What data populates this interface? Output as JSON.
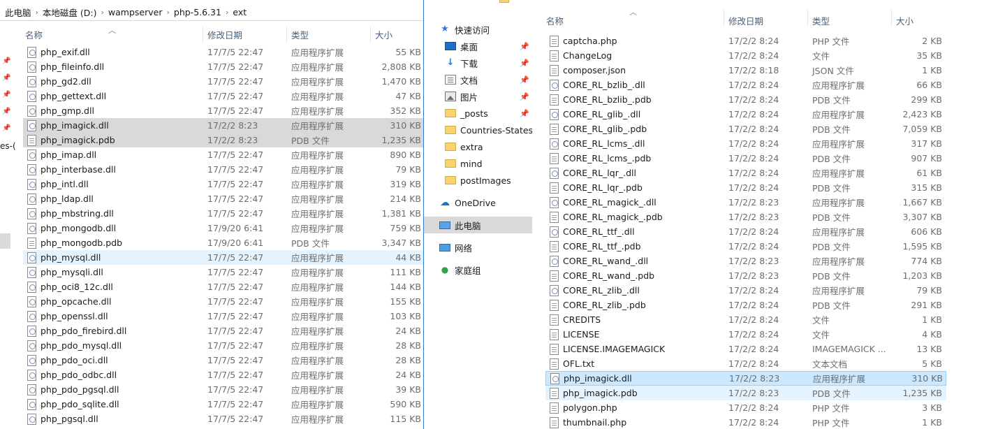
{
  "left": {
    "breadcrumb": [
      "此电脑",
      "本地磁盘 (D:)",
      "wampserver",
      "php-5.6.31",
      "ext"
    ],
    "nav_fragment": "es-(",
    "columns": {
      "name": "名称",
      "date": "修改日期",
      "type": "类型",
      "size": "大小"
    },
    "files": [
      {
        "name": "php_exif.dll",
        "date": "17/7/5 22:47",
        "type": "应用程序扩展",
        "size": "55 KB",
        "icon": "dll"
      },
      {
        "name": "php_fileinfo.dll",
        "date": "17/7/5 22:47",
        "type": "应用程序扩展",
        "size": "2,808 KB",
        "icon": "dll"
      },
      {
        "name": "php_gd2.dll",
        "date": "17/7/5 22:47",
        "type": "应用程序扩展",
        "size": "1,470 KB",
        "icon": "dll"
      },
      {
        "name": "php_gettext.dll",
        "date": "17/7/5 22:47",
        "type": "应用程序扩展",
        "size": "47 KB",
        "icon": "dll"
      },
      {
        "name": "php_gmp.dll",
        "date": "17/7/5 22:47",
        "type": "应用程序扩展",
        "size": "352 KB",
        "icon": "dll"
      },
      {
        "name": "php_imagick.dll",
        "date": "17/2/2 8:23",
        "type": "应用程序扩展",
        "size": "310 KB",
        "icon": "dll"
      },
      {
        "name": "php_imagick.pdb",
        "date": "17/2/2 8:23",
        "type": "PDB 文件",
        "size": "1,235 KB",
        "icon": "doc"
      },
      {
        "name": "php_imap.dll",
        "date": "17/7/5 22:47",
        "type": "应用程序扩展",
        "size": "890 KB",
        "icon": "dll"
      },
      {
        "name": "php_interbase.dll",
        "date": "17/7/5 22:47",
        "type": "应用程序扩展",
        "size": "79 KB",
        "icon": "dll"
      },
      {
        "name": "php_intl.dll",
        "date": "17/7/5 22:47",
        "type": "应用程序扩展",
        "size": "319 KB",
        "icon": "dll"
      },
      {
        "name": "php_ldap.dll",
        "date": "17/7/5 22:47",
        "type": "应用程序扩展",
        "size": "214 KB",
        "icon": "dll"
      },
      {
        "name": "php_mbstring.dll",
        "date": "17/7/5 22:47",
        "type": "应用程序扩展",
        "size": "1,381 KB",
        "icon": "dll"
      },
      {
        "name": "php_mongodb.dll",
        "date": "17/9/20 6:41",
        "type": "应用程序扩展",
        "size": "759 KB",
        "icon": "dll"
      },
      {
        "name": "php_mongodb.pdb",
        "date": "17/9/20 6:41",
        "type": "PDB 文件",
        "size": "3,347 KB",
        "icon": "doc"
      },
      {
        "name": "php_mysql.dll",
        "date": "17/7/5 22:47",
        "type": "应用程序扩展",
        "size": "44 KB",
        "icon": "dll"
      },
      {
        "name": "php_mysqli.dll",
        "date": "17/7/5 22:47",
        "type": "应用程序扩展",
        "size": "111 KB",
        "icon": "dll"
      },
      {
        "name": "php_oci8_12c.dll",
        "date": "17/7/5 22:47",
        "type": "应用程序扩展",
        "size": "144 KB",
        "icon": "dll"
      },
      {
        "name": "php_opcache.dll",
        "date": "17/7/5 22:47",
        "type": "应用程序扩展",
        "size": "155 KB",
        "icon": "dll"
      },
      {
        "name": "php_openssl.dll",
        "date": "17/7/5 22:47",
        "type": "应用程序扩展",
        "size": "103 KB",
        "icon": "dll"
      },
      {
        "name": "php_pdo_firebird.dll",
        "date": "17/7/5 22:47",
        "type": "应用程序扩展",
        "size": "24 KB",
        "icon": "dll"
      },
      {
        "name": "php_pdo_mysql.dll",
        "date": "17/7/5 22:47",
        "type": "应用程序扩展",
        "size": "28 KB",
        "icon": "dll"
      },
      {
        "name": "php_pdo_oci.dll",
        "date": "17/7/5 22:47",
        "type": "应用程序扩展",
        "size": "28 KB",
        "icon": "dll"
      },
      {
        "name": "php_pdo_odbc.dll",
        "date": "17/7/5 22:47",
        "type": "应用程序扩展",
        "size": "24 KB",
        "icon": "dll"
      },
      {
        "name": "php_pdo_pgsql.dll",
        "date": "17/7/5 22:47",
        "type": "应用程序扩展",
        "size": "39 KB",
        "icon": "dll"
      },
      {
        "name": "php_pdo_sqlite.dll",
        "date": "17/7/5 22:47",
        "type": "应用程序扩展",
        "size": "590 KB",
        "icon": "dll"
      },
      {
        "name": "php_pgsql.dll",
        "date": "17/7/5 22:47",
        "type": "应用程序扩展",
        "size": "115 KB",
        "icon": "dll"
      }
    ]
  },
  "right": {
    "nav": [
      {
        "label": "快速访问",
        "icon": "star-icon",
        "pinned": false
      },
      {
        "label": "桌面",
        "icon": "desktop-icon",
        "pinned": true
      },
      {
        "label": "下载",
        "icon": "download-icon",
        "pinned": true
      },
      {
        "label": "文档",
        "icon": "docs-icon",
        "pinned": true
      },
      {
        "label": "图片",
        "icon": "pics-icon",
        "pinned": true
      },
      {
        "label": "_posts",
        "icon": "folder-icon",
        "pinned": true
      },
      {
        "label": "Countries-States-C",
        "icon": "folder-icon",
        "pinned": false
      },
      {
        "label": "extra",
        "icon": "folder-icon",
        "pinned": false
      },
      {
        "label": "mind",
        "icon": "folder-icon",
        "pinned": false
      },
      {
        "label": "postImages",
        "icon": "folder-icon",
        "pinned": false
      },
      {
        "label": "OneDrive",
        "icon": "cloud-icon",
        "pinned": false
      },
      {
        "label": "此电脑",
        "icon": "pc-icon",
        "pinned": false
      },
      {
        "label": "网络",
        "icon": "net-icon",
        "pinned": false
      },
      {
        "label": "家庭组",
        "icon": "home-icon",
        "pinned": false
      }
    ],
    "columns": {
      "name": "名称",
      "date": "修改日期",
      "type": "类型",
      "size": "大小"
    },
    "files": [
      {
        "name": "captcha.php",
        "date": "17/2/2 8:24",
        "type": "PHP 文件",
        "size": "2 KB",
        "icon": "doc"
      },
      {
        "name": "ChangeLog",
        "date": "17/2/2 8:24",
        "type": "文件",
        "size": "35 KB",
        "icon": "doc"
      },
      {
        "name": "composer.json",
        "date": "17/2/2 8:18",
        "type": "JSON 文件",
        "size": "1 KB",
        "icon": "doc"
      },
      {
        "name": "CORE_RL_bzlib_.dll",
        "date": "17/2/2 8:24",
        "type": "应用程序扩展",
        "size": "66 KB",
        "icon": "dll"
      },
      {
        "name": "CORE_RL_bzlib_.pdb",
        "date": "17/2/2 8:24",
        "type": "PDB 文件",
        "size": "299 KB",
        "icon": "doc"
      },
      {
        "name": "CORE_RL_glib_.dll",
        "date": "17/2/2 8:24",
        "type": "应用程序扩展",
        "size": "2,423 KB",
        "icon": "dll"
      },
      {
        "name": "CORE_RL_glib_.pdb",
        "date": "17/2/2 8:24",
        "type": "PDB 文件",
        "size": "7,059 KB",
        "icon": "doc"
      },
      {
        "name": "CORE_RL_lcms_.dll",
        "date": "17/2/2 8:24",
        "type": "应用程序扩展",
        "size": "317 KB",
        "icon": "dll"
      },
      {
        "name": "CORE_RL_lcms_.pdb",
        "date": "17/2/2 8:24",
        "type": "PDB 文件",
        "size": "907 KB",
        "icon": "doc"
      },
      {
        "name": "CORE_RL_lqr_.dll",
        "date": "17/2/2 8:24",
        "type": "应用程序扩展",
        "size": "61 KB",
        "icon": "dll"
      },
      {
        "name": "CORE_RL_lqr_.pdb",
        "date": "17/2/2 8:24",
        "type": "PDB 文件",
        "size": "315 KB",
        "icon": "doc"
      },
      {
        "name": "CORE_RL_magick_.dll",
        "date": "17/2/2 8:23",
        "type": "应用程序扩展",
        "size": "1,667 KB",
        "icon": "dll"
      },
      {
        "name": "CORE_RL_magick_.pdb",
        "date": "17/2/2 8:23",
        "type": "PDB 文件",
        "size": "3,307 KB",
        "icon": "doc"
      },
      {
        "name": "CORE_RL_ttf_.dll",
        "date": "17/2/2 8:24",
        "type": "应用程序扩展",
        "size": "606 KB",
        "icon": "dll"
      },
      {
        "name": "CORE_RL_ttf_.pdb",
        "date": "17/2/2 8:24",
        "type": "PDB 文件",
        "size": "1,595 KB",
        "icon": "doc"
      },
      {
        "name": "CORE_RL_wand_.dll",
        "date": "17/2/2 8:23",
        "type": "应用程序扩展",
        "size": "774 KB",
        "icon": "dll"
      },
      {
        "name": "CORE_RL_wand_.pdb",
        "date": "17/2/2 8:23",
        "type": "PDB 文件",
        "size": "1,203 KB",
        "icon": "doc"
      },
      {
        "name": "CORE_RL_zlib_.dll",
        "date": "17/2/2 8:24",
        "type": "应用程序扩展",
        "size": "79 KB",
        "icon": "dll"
      },
      {
        "name": "CORE_RL_zlib_.pdb",
        "date": "17/2/2 8:24",
        "type": "PDB 文件",
        "size": "291 KB",
        "icon": "doc"
      },
      {
        "name": "CREDITS",
        "date": "17/2/2 8:24",
        "type": "文件",
        "size": "1 KB",
        "icon": "doc"
      },
      {
        "name": "LICENSE",
        "date": "17/2/2 8:24",
        "type": "文件",
        "size": "4 KB",
        "icon": "doc"
      },
      {
        "name": "LICENSE.IMAGEMAGICK",
        "date": "17/2/2 8:24",
        "type": "IMAGEMAGICK ...",
        "size": "13 KB",
        "icon": "doc"
      },
      {
        "name": "OFL.txt",
        "date": "17/2/2 8:24",
        "type": "文本文档",
        "size": "5 KB",
        "icon": "doc"
      },
      {
        "name": "php_imagick.dll",
        "date": "17/2/2 8:23",
        "type": "应用程序扩展",
        "size": "310 KB",
        "icon": "dll"
      },
      {
        "name": "php_imagick.pdb",
        "date": "17/2/2 8:23",
        "type": "PDB 文件",
        "size": "1,235 KB",
        "icon": "doc"
      },
      {
        "name": "polygon.php",
        "date": "17/2/2 8:24",
        "type": "PHP 文件",
        "size": "3 KB",
        "icon": "doc"
      },
      {
        "name": "thumbnail.php",
        "date": "17/2/2 8:24",
        "type": "PHP 文件",
        "size": "1 KB",
        "icon": "doc"
      }
    ]
  }
}
